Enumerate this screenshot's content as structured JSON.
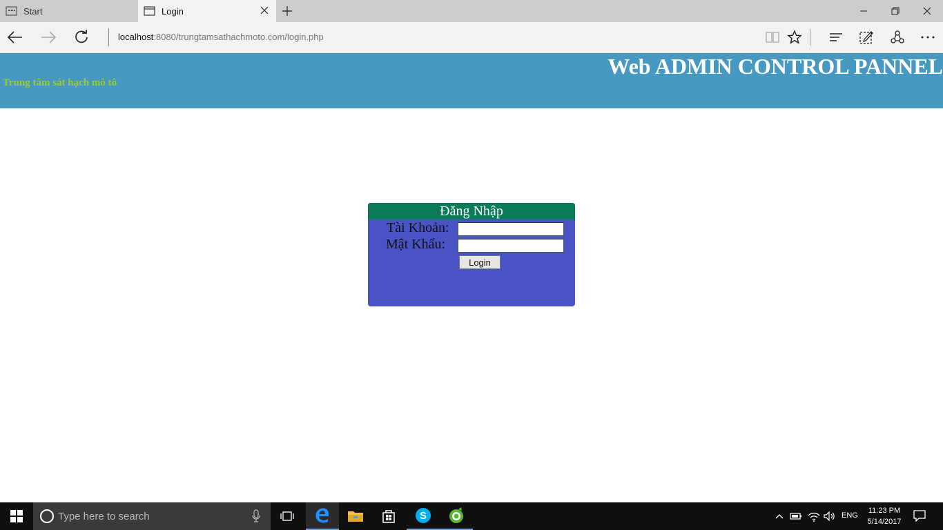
{
  "browser": {
    "tabs": [
      {
        "label": "Start",
        "icon": "start-page-icon"
      },
      {
        "label": "Login",
        "icon": "page-icon"
      }
    ],
    "address": {
      "host": "localhost",
      "rest": ":8080/trungtamsathachmoto.com/login.php"
    }
  },
  "header": {
    "title": "Web ADMIN CONTROL PANNEL",
    "subtitle": "Trung tâm sát hạch mô tô",
    "colors": {
      "background": "#4799c1",
      "subtitle": "#9acd32"
    }
  },
  "login": {
    "title": "Đăng Nhập",
    "username_label": "Tài Khoản:",
    "password_label": "Mật Khẩu:",
    "username_value": "",
    "password_value": "",
    "button_label": "Login",
    "colors": {
      "panel": "#4953c3",
      "titlebar": "#0b7a5a"
    }
  },
  "taskbar": {
    "search_placeholder": "Type here to search",
    "apps": [
      "task-view-icon",
      "edge-icon",
      "file-explorer-icon",
      "store-icon",
      "skype-icon",
      "coccoc-icon"
    ],
    "language": "ENG",
    "time": "11:23 PM",
    "date": "5/14/2017"
  }
}
